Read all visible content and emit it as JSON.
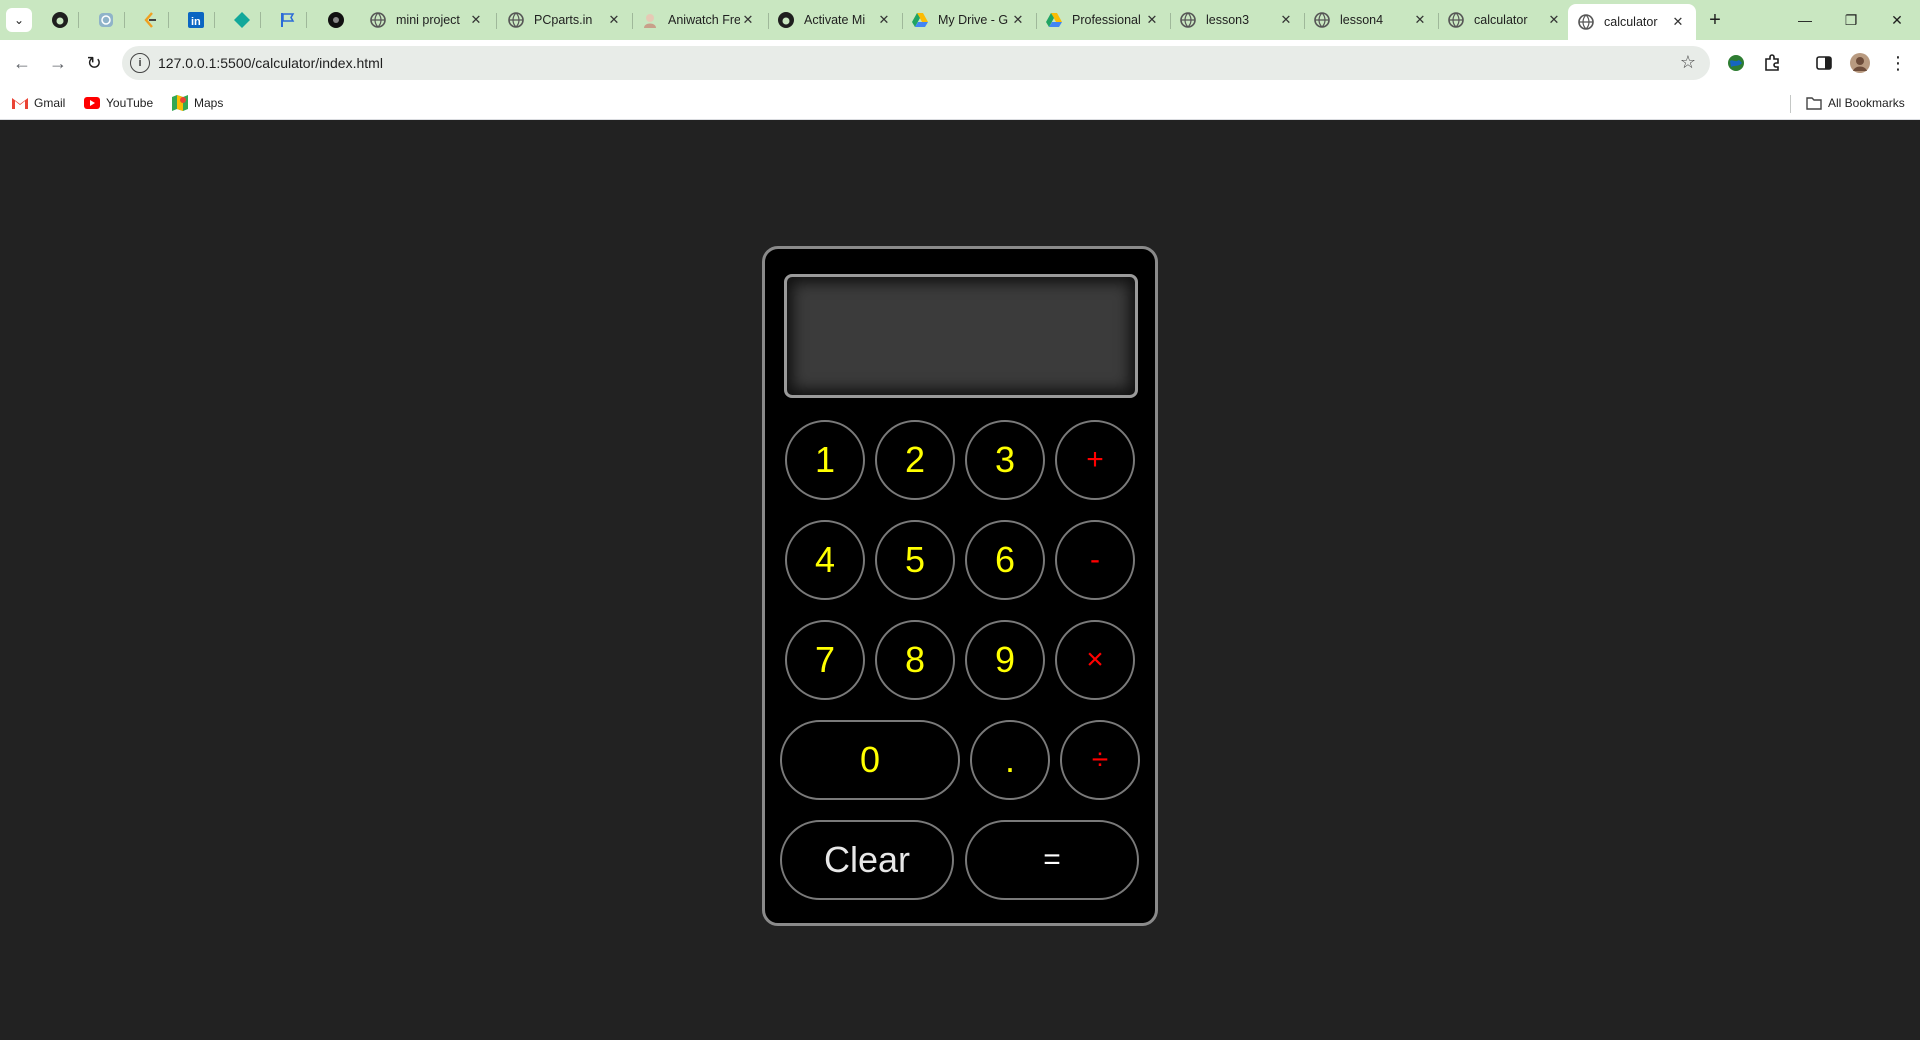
{
  "browser": {
    "tabs": [
      {
        "title": "mini project"
      },
      {
        "title": "PCparts.in"
      },
      {
        "title": "Aniwatch Free"
      },
      {
        "title": "Activate Mi"
      },
      {
        "title": "My Drive - G"
      },
      {
        "title": "Professional"
      },
      {
        "title": "lesson3"
      },
      {
        "title": "lesson4"
      },
      {
        "title": "calculator"
      },
      {
        "title": "calculator"
      }
    ],
    "new_tab": "+",
    "window": {
      "minimize": "—",
      "restore": "❐",
      "close": "✕"
    },
    "url": "127.0.0.1:5500/calculator/index.html",
    "bookmarks": [
      {
        "label": "Gmail"
      },
      {
        "label": "YouTube"
      },
      {
        "label": "Maps"
      }
    ],
    "all_bookmarks": "All Bookmarks"
  },
  "calculator": {
    "display": "",
    "keys": {
      "k1": "1",
      "k2": "2",
      "k3": "3",
      "plus": "+",
      "k4": "4",
      "k5": "5",
      "k6": "6",
      "minus": "-",
      "k7": "7",
      "k8": "8",
      "k9": "9",
      "times": "×",
      "k0": "0",
      "dot": ".",
      "divide": "÷",
      "clear": "Clear",
      "equals": "="
    }
  },
  "colors": {
    "page_bg": "#222222",
    "calc_bg": "#000000",
    "digit": "#ffff00",
    "operator": "#ff0000",
    "tabstrip": "#c9e7c1"
  }
}
